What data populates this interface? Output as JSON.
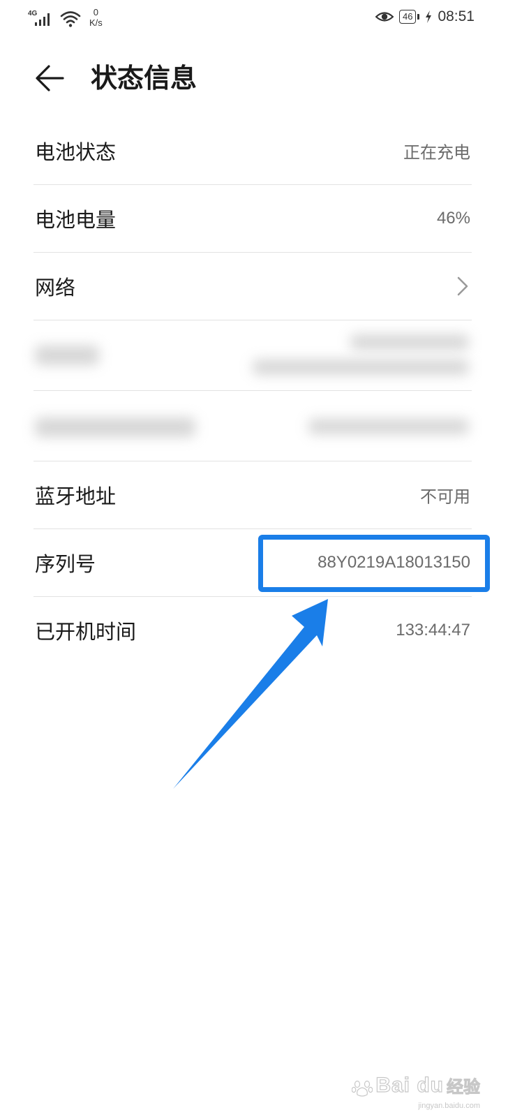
{
  "status_bar": {
    "network_type": "4G",
    "speed_value": "0",
    "speed_unit": "K/s",
    "battery_level": "46",
    "time": "08:51"
  },
  "header": {
    "title": "状态信息"
  },
  "rows": [
    {
      "label": "电池状态",
      "value": "正在充电"
    },
    {
      "label": "电池电量",
      "value": "46%"
    },
    {
      "label": "网络"
    },
    {
      "label": "蓝牙地址",
      "value": "不可用"
    },
    {
      "label": "序列号",
      "value": "88Y0219A18013150"
    },
    {
      "label": "已开机时间",
      "value": "133:44:47"
    }
  ],
  "watermark": {
    "brand": "Bai du",
    "suffix": "经验",
    "url": "jingyan.baidu.com"
  },
  "colors": {
    "annotation_blue": "#1a7ee8",
    "divider": "#e2e2e2",
    "value_gray": "#6b6b6b"
  }
}
